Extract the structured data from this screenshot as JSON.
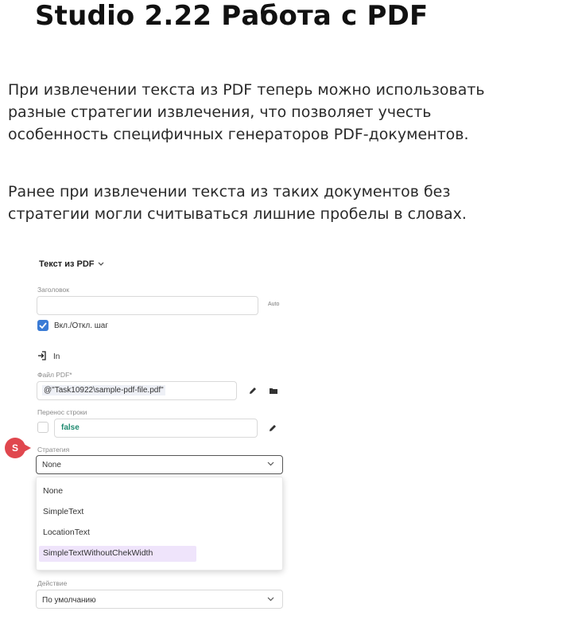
{
  "slide": {
    "title": "Studio 2.22 Работа с PDF",
    "paragraph1": [
      "При извлечении текста из PDF теперь можно использовать",
      "разные стратегии извлечения, что позволяет учесть",
      "особенность специфичных генераторов PDF-документов."
    ],
    "paragraph2": [
      "Ранее при извлечении текста из таких документов без",
      "стратегии могли считываться лишние пробелы в словах."
    ]
  },
  "panel": {
    "activity_title": "Текст из PDF",
    "header_label": "Заголовок",
    "header_value": "",
    "auto_label": "Auto",
    "toggle_label": "Вкл./Откл. шаг",
    "toggle_checked": true,
    "in_label": "In",
    "file_label": "Файл PDF*",
    "file_value": "@\"Task10922\\sample-pdf-file.pdf\"",
    "wrap_label": "Перенос строки",
    "wrap_value": "false",
    "strategy_label": "Стратегия",
    "strategy_value": "None",
    "strategy_options": [
      "None",
      "SimpleText",
      "LocationText",
      "SimpleTextWithoutChekWidth"
    ],
    "highlighted_option": "SimpleTextWithoutChekWidth",
    "action_label": "Действие",
    "action_value": "По умолчанию",
    "badge_letter": "S",
    "accent_color": "#3a7bd5",
    "badge_color": "#e0474e",
    "false_color": "#1f8a70",
    "highlight_color": "#efe4fb",
    "icons": [
      "chevron-down-icon",
      "checkmark-icon",
      "sign-in-icon",
      "pencil-icon",
      "folder-icon"
    ]
  }
}
